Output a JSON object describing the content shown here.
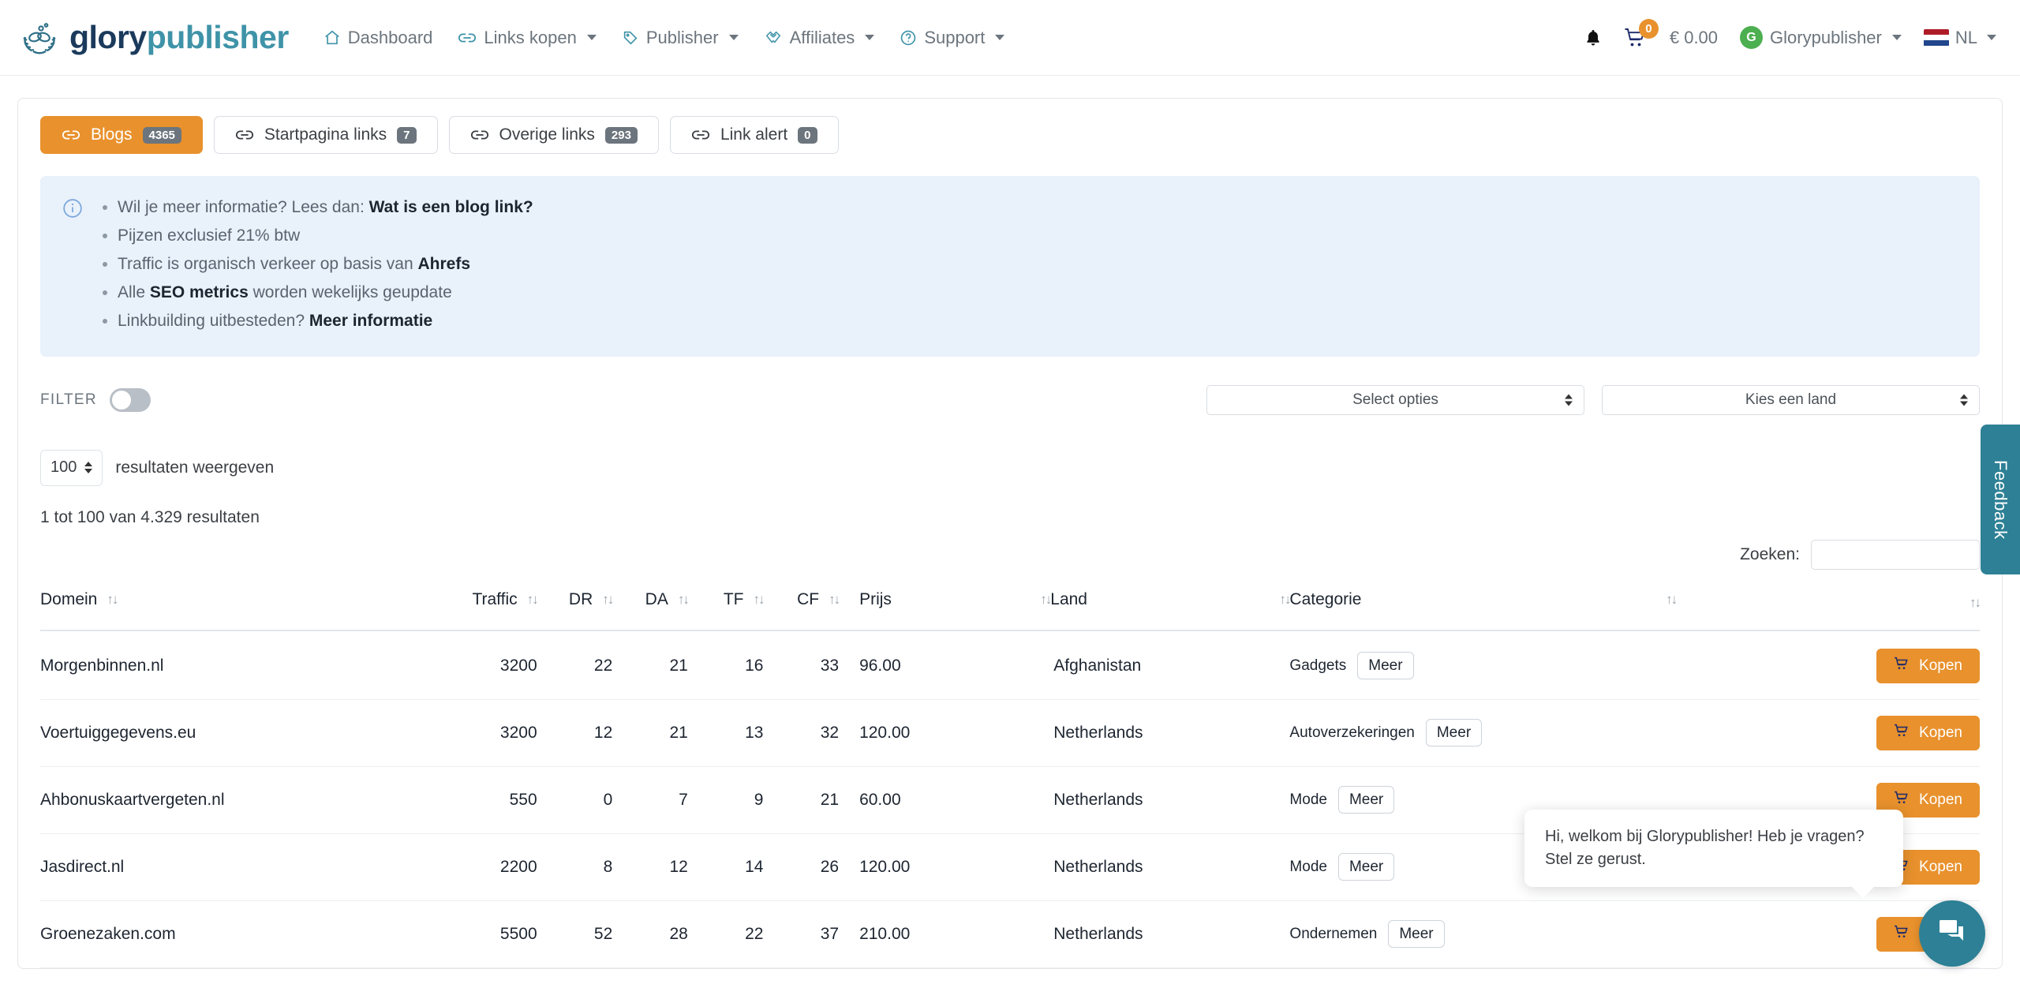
{
  "brand": {
    "name_part1": "glory",
    "name_part2": "publisher",
    "logo_icon": "wreath-link-logo-icon"
  },
  "nav": {
    "items": [
      {
        "label": "Dashboard",
        "icon": "home-icon",
        "caret": false
      },
      {
        "label": "Links kopen",
        "icon": "link-icon",
        "caret": true
      },
      {
        "label": "Publisher",
        "icon": "tag-icon",
        "caret": true
      },
      {
        "label": "Affiliates",
        "icon": "handshake-icon",
        "caret": true
      },
      {
        "label": "Support",
        "icon": "question-circle-icon",
        "caret": true
      }
    ],
    "right": {
      "bell_icon": "bell-icon",
      "cart_icon": "shopping-cart-icon",
      "cart_count": "0",
      "balance": "€ 0.00",
      "avatar_letter": "G",
      "user_name": "Glorypublisher",
      "lang_code": "NL",
      "flag": "netherlands-flag-icon"
    }
  },
  "tabs": [
    {
      "label": "Blogs",
      "count": "4365",
      "active": true
    },
    {
      "label": "Startpagina links",
      "count": "7",
      "active": false
    },
    {
      "label": "Overige links",
      "count": "293",
      "active": false
    },
    {
      "label": "Link alert",
      "count": "0",
      "active": false
    }
  ],
  "alert": {
    "icon": "info-circle-icon",
    "items": [
      {
        "text": "Wil je meer informatie? Lees dan: ",
        "strong": "Wat is een blog link?"
      },
      {
        "text": "Pijzen exclusief 21% btw",
        "strong": ""
      },
      {
        "text": "Traffic is organisch verkeer op basis van ",
        "strong": "Ahrefs"
      },
      {
        "text": "Alle ",
        "strong": "SEO metrics",
        "text_after": " worden wekelijks geupdate"
      },
      {
        "text": "Linkbuilding uitbesteden? ",
        "strong": "Meer informatie"
      }
    ]
  },
  "filter": {
    "label": "FILTER",
    "toggle_state": "off",
    "select_options_placeholder": "Select opties",
    "select_country_placeholder": "Kies een land"
  },
  "table_controls": {
    "page_length": "100",
    "length_label": "resultaten weergeven",
    "info": "1 tot 100 van 4.329 resultaten",
    "search_label": "Zoeken:",
    "search_value": "",
    "search_placeholder": ""
  },
  "table": {
    "columns": [
      {
        "key": "domein",
        "label": "Domein",
        "sortable": true,
        "align": "left"
      },
      {
        "key": "traffic",
        "label": "Traffic",
        "sortable": true,
        "align": "right"
      },
      {
        "key": "dr",
        "label": "DR",
        "sortable": true,
        "align": "right"
      },
      {
        "key": "da",
        "label": "DA",
        "sortable": true,
        "align": "right"
      },
      {
        "key": "tf",
        "label": "TF",
        "sortable": true,
        "align": "right"
      },
      {
        "key": "cf",
        "label": "CF",
        "sortable": true,
        "align": "right"
      },
      {
        "key": "prijs",
        "label": "Prijs",
        "sortable": true,
        "align": "left"
      },
      {
        "key": "land",
        "label": "Land",
        "sortable": true,
        "align": "left"
      },
      {
        "key": "categorie",
        "label": "Categorie",
        "sortable": true,
        "align": "left"
      },
      {
        "key": "kopen",
        "label": "",
        "sortable": true,
        "align": "right"
      }
    ],
    "more_label": "Meer",
    "buy_label": "Kopen",
    "buy_icon": "shopping-cart-icon",
    "rows": [
      {
        "domein": "Morgenbinnen.nl",
        "traffic": "3200",
        "dr": "22",
        "da": "21",
        "tf": "16",
        "cf": "33",
        "prijs": "96.00",
        "land": "Afghanistan",
        "categorie": "Gadgets"
      },
      {
        "domein": "Voertuiggegevens.eu",
        "traffic": "3200",
        "dr": "12",
        "da": "21",
        "tf": "13",
        "cf": "32",
        "prijs": "120.00",
        "land": "Netherlands",
        "categorie": "Autoverzekeringen"
      },
      {
        "domein": "Ahbonuskaartvergeten.nl",
        "traffic": "550",
        "dr": "0",
        "da": "7",
        "tf": "9",
        "cf": "21",
        "prijs": "60.00",
        "land": "Netherlands",
        "categorie": "Mode"
      },
      {
        "domein": "Jasdirect.nl",
        "traffic": "2200",
        "dr": "8",
        "da": "12",
        "tf": "14",
        "cf": "26",
        "prijs": "120.00",
        "land": "Netherlands",
        "categorie": "Mode"
      },
      {
        "domein": "Groenezaken.com",
        "traffic": "5500",
        "dr": "52",
        "da": "28",
        "tf": "22",
        "cf": "37",
        "prijs": "210.00",
        "land": "Netherlands",
        "categorie": "Ondernemen"
      }
    ]
  },
  "widgets": {
    "feedback_label": "Feedback",
    "chat_message": "Hi, welkom bij Glorypublisher! Heb je vragen? Stel ze gerust.",
    "chat_icon": "chat-bubbles-icon"
  },
  "colors": {
    "accent_orange": "#e8912d",
    "brand_teal": "#3f93a8",
    "brand_navy": "#1b3a5c",
    "widget_teal": "#2d8095",
    "alert_bg": "#e9f1fb",
    "badge_gray": "#6c757d"
  }
}
